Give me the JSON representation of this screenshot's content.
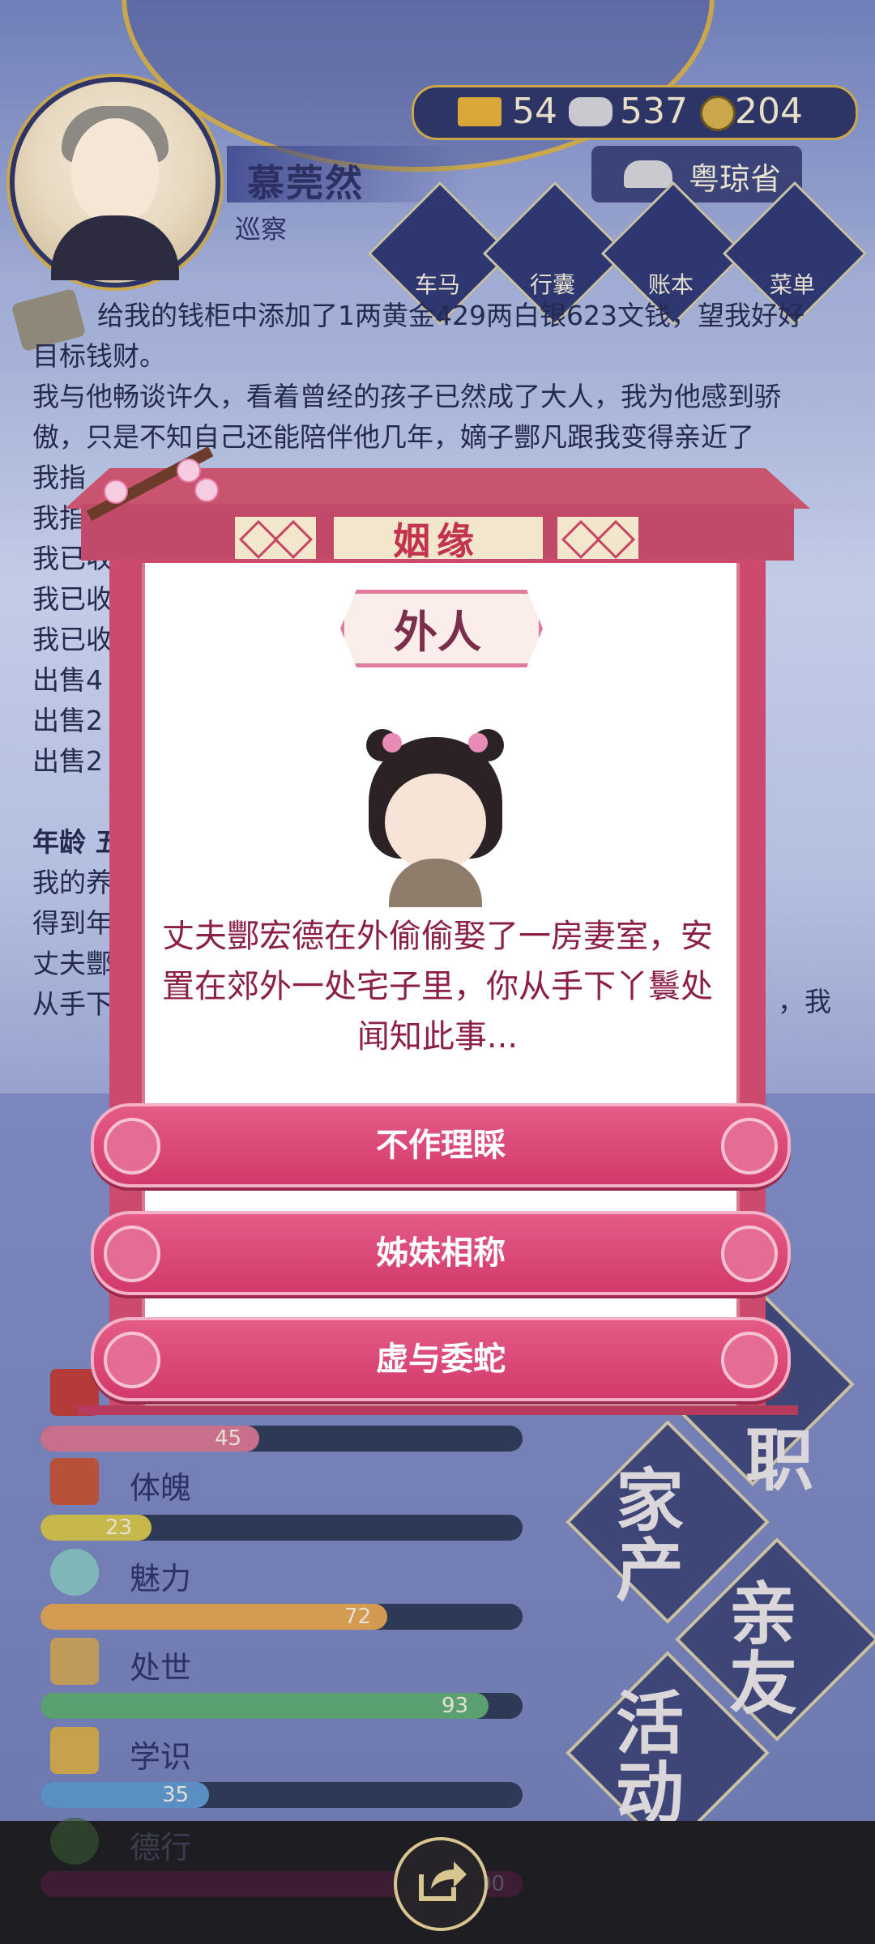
{
  "player": {
    "name": "慕莞然",
    "title": "巡察"
  },
  "resources": {
    "gold": "54",
    "silver": "537",
    "coins": "204"
  },
  "province": "粤琼省",
  "top_menu": [
    {
      "label": "车马"
    },
    {
      "label": "行囊"
    },
    {
      "label": "账本"
    },
    {
      "label": "菜单"
    }
  ],
  "log": {
    "lines": [
      "给我的钱柜中添加了1两黄金429两白银623文钱，望我好好",
      "目标钱财。",
      "我与他畅谈许久，看着曾经的孩子已然成了大人，我为他感到骄",
      "傲，只是不知自己还能陪伴他几年，嫡子酆凡跟我变得亲近了",
      "我指",
      "我指",
      "我已收",
      "我已收",
      "我已收",
      "出售4",
      "出售2",
      "出售2"
    ],
    "age_header": "年龄 五",
    "lines2": [
      "我的养",
      "得到年",
      "丈夫酆",
      "从手下"
    ],
    "tail": "，我"
  },
  "stats": [
    {
      "label": "",
      "value": 45
    },
    {
      "label": "体魄",
      "value": 23
    },
    {
      "label": "魅力",
      "value": 72
    },
    {
      "label": "处世",
      "value": 93
    },
    {
      "label": "学识",
      "value": 35
    },
    {
      "label": "德行",
      "value": 100
    }
  ],
  "stat_value_labels": [
    "45",
    "23",
    "72",
    "93",
    "35",
    "00"
  ],
  "side_actions": [
    "职",
    "家产",
    "亲友",
    "活动"
  ],
  "dialog": {
    "header": "姻缘",
    "tag": "外人",
    "story": "丈夫酆宏德在外偷偷娶了一房妻室，安置在郊外一处宅子里，你从手下丫鬟处闻知此事...",
    "options": [
      "不作理睬",
      "姊妹相称",
      "虚与委蛇"
    ]
  },
  "colors": {
    "dialog_frame": "#cc4a6c",
    "option_button": "#d23a6a",
    "story_text": "#8c1f47",
    "ui_navy": "#2d3566",
    "gold_trim": "#c9a74a"
  },
  "icons": {
    "share": "share-icon"
  }
}
